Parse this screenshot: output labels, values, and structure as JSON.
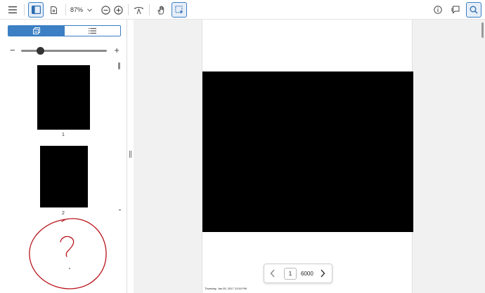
{
  "toolbar": {
    "zoom_value": "87%",
    "icons": [
      "menu-icon",
      "sidebar-toggle-icon",
      "document-icon",
      "chevron-down-icon",
      "zoom-out-icon",
      "zoom-in-icon",
      "pan-mode-icon",
      "hand-tool-icon",
      "selection-tool-icon",
      "info-icon",
      "comment-icon",
      "search-icon"
    ]
  },
  "sidebar": {
    "view_modes": [
      "thumbnails-view",
      "outline-view"
    ],
    "selected_mode": "thumbnails-view",
    "thumbnail_zoom_level": 0.2,
    "thumbnails": [
      {
        "label": "1"
      },
      {
        "label": "2"
      }
    ]
  },
  "annotation": {
    "text": "?"
  },
  "document": {
    "footer_text": "Thursday, Jan 05, 2017  12:50 PM"
  },
  "pager": {
    "current_page": "1",
    "total_pages": "6000"
  },
  "colors": {
    "accent": "#3b7fc4",
    "annotation_ink": "#b8141b",
    "viewer_background": "#f1f1f1"
  }
}
